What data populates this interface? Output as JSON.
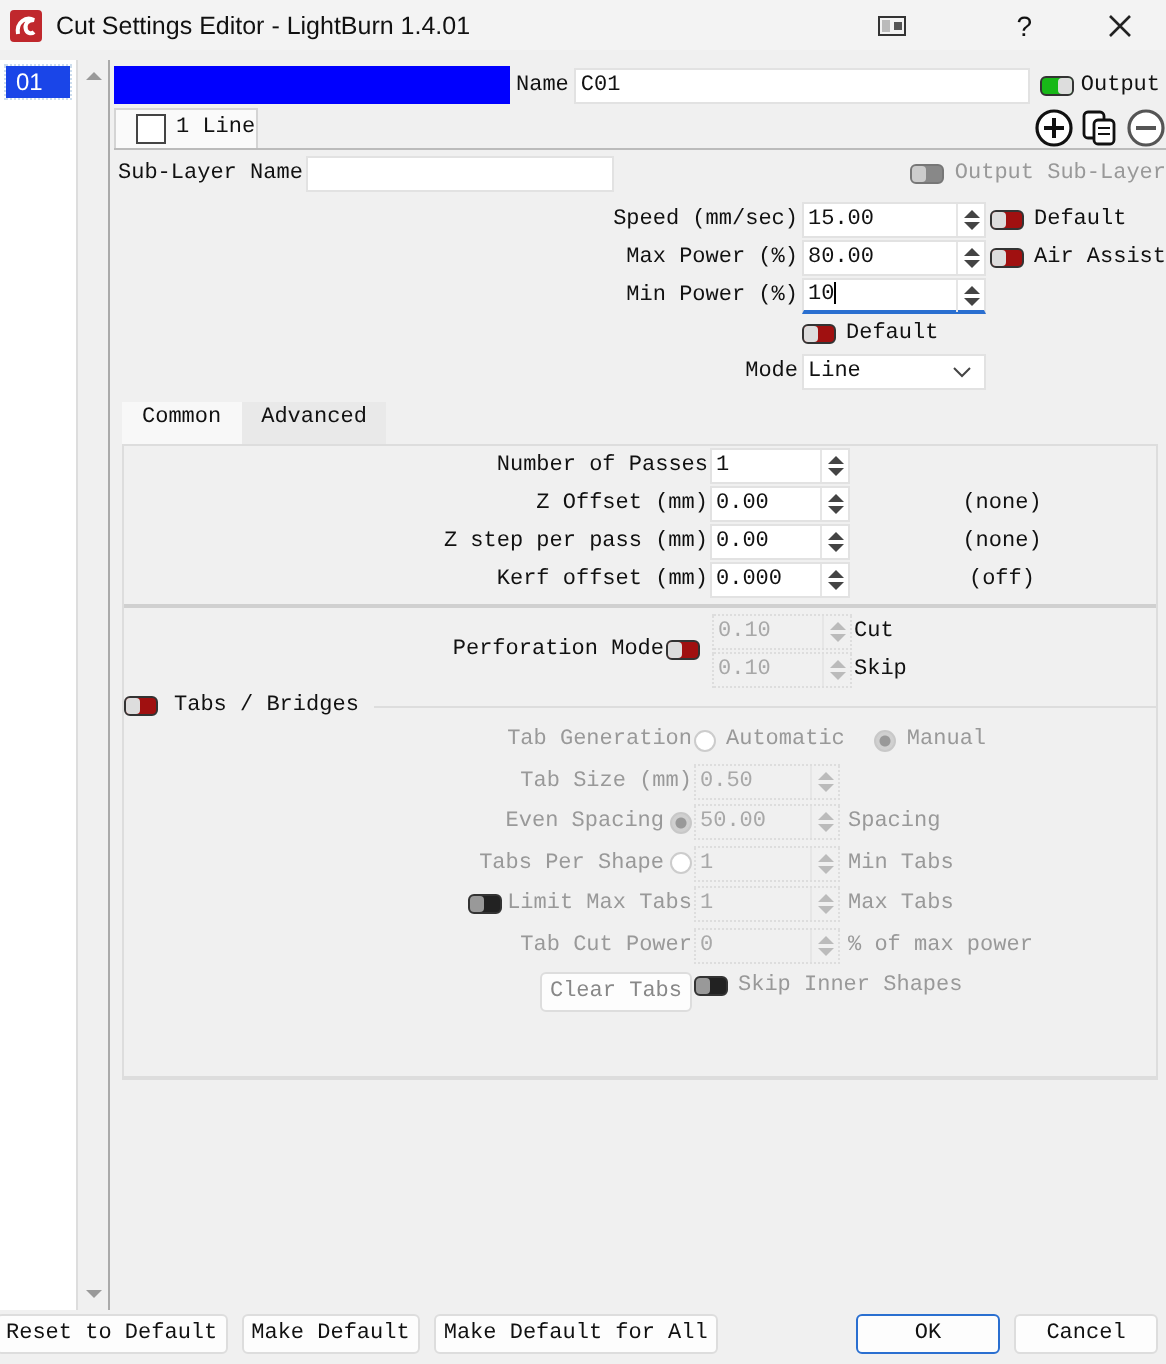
{
  "window": {
    "title": "Cut Settings Editor - LightBurn 1.4.01",
    "help": "?"
  },
  "layers": [
    {
      "label": "01",
      "selected": true
    }
  ],
  "layer": {
    "color": "#0000ff",
    "name_label": "Name",
    "name": "C01",
    "output": {
      "label": "Output",
      "on": true
    }
  },
  "sublayers": [
    {
      "label": "1 Line",
      "selected": true,
      "checked": false
    }
  ],
  "sublayer_name": {
    "label": "Sub-Layer Name"
  },
  "output_sublayer": {
    "label": "Output Sub-Layer",
    "on": false,
    "disabled": true
  },
  "power_fields": [
    {
      "label": "Speed (mm/sec)",
      "value": "15.00",
      "focused": false,
      "toggle": {
        "label": "Default",
        "on": false
      }
    },
    {
      "label": "Max Power (%)",
      "value": "80.00",
      "focused": false,
      "toggle": {
        "label": "Air Assist",
        "on": false
      }
    },
    {
      "label": "Min Power (%)",
      "value": "10",
      "focused": true
    }
  ],
  "min_power_default": {
    "label": "Default",
    "on": false
  },
  "mode": {
    "label": "Mode",
    "value": "Line"
  },
  "settings_tabs": [
    {
      "label": "Common",
      "selected": true
    },
    {
      "label": "Advanced",
      "selected": false
    }
  ],
  "common_fields": [
    {
      "label": "Number of Passes",
      "value": "1"
    },
    {
      "label": "Z Offset (mm)",
      "value": "0.00",
      "note": "(none)"
    },
    {
      "label": "Z step per pass (mm)",
      "value": "0.00",
      "note": "(none)"
    },
    {
      "label": "Kerf offset (mm)",
      "value": "0.000",
      "note": "(off)"
    }
  ],
  "perforation": {
    "label": "Perforation Mode",
    "on": false,
    "fields": [
      {
        "value": "0.10",
        "label": "Cut",
        "disabled": true
      },
      {
        "value": "0.10",
        "label": "Skip",
        "disabled": true
      }
    ]
  },
  "tabs_bridges": {
    "label": "Tabs / Bridges",
    "on": false,
    "disabled": true,
    "tab_generation": {
      "label": "Tab Generation",
      "options": [
        {
          "label": "Automatic",
          "selected": false
        },
        {
          "label": "Manual",
          "selected": true
        }
      ]
    },
    "rows": [
      {
        "kind": "plain",
        "label": "Tab Size (mm)",
        "value": "0.50"
      },
      {
        "kind": "radio",
        "label": "Even Spacing",
        "selected": true,
        "value": "50.00",
        "unit": "Spacing"
      },
      {
        "kind": "radio",
        "label": "Tabs Per Shape",
        "selected": false,
        "value": "1",
        "unit": "Min Tabs"
      },
      {
        "kind": "toggle",
        "label": "Limit Max Tabs",
        "on": false,
        "value": "1",
        "unit": "Max Tabs"
      },
      {
        "kind": "plain",
        "label": "Tab Cut Power",
        "value": "0",
        "unit": "% of max power"
      }
    ],
    "clear_button": "Clear Tabs",
    "skip_inner": {
      "label": "Skip Inner Shapes",
      "on": false
    }
  },
  "footer_buttons": [
    {
      "label": "Reset to Default",
      "kind": "left",
      "default": false
    },
    {
      "label": "Make Default",
      "kind": "left",
      "default": false
    },
    {
      "label": "Make Default for All",
      "kind": "left",
      "default": false
    },
    {
      "label": "OK",
      "kind": "right",
      "default": true
    },
    {
      "label": "Cancel",
      "kind": "right",
      "default": false
    }
  ]
}
